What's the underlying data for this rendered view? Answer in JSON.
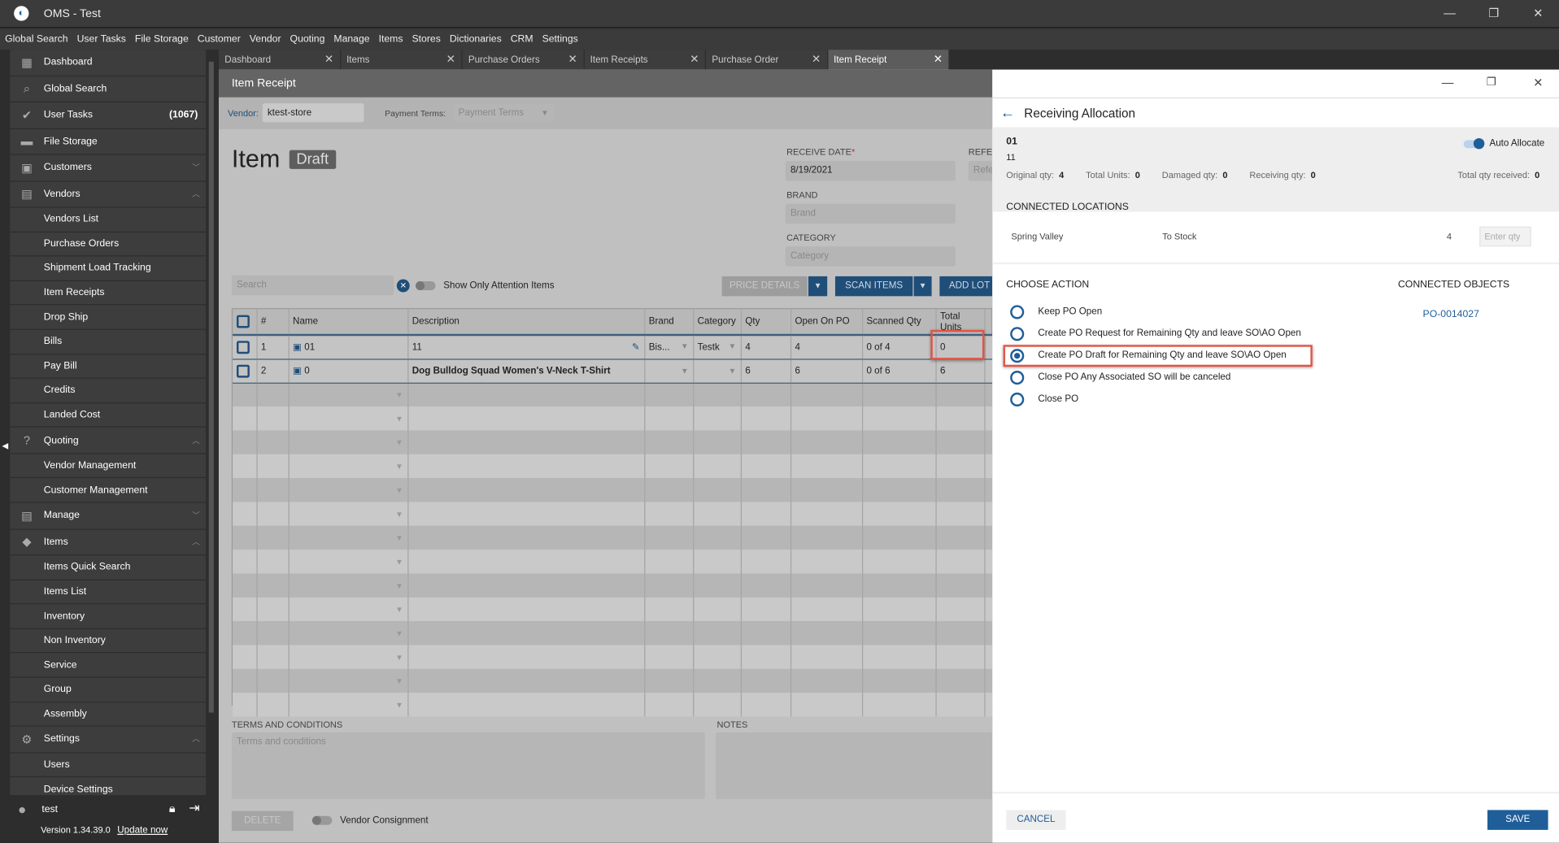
{
  "app": {
    "title": "OMS - Test"
  },
  "menu": [
    "Global Search",
    "User Tasks",
    "File Storage",
    "Customer",
    "Vendor",
    "Quoting",
    "Manage",
    "Items",
    "Stores",
    "Dictionaries",
    "CRM",
    "Settings"
  ],
  "sidebar": {
    "items": [
      {
        "label": "Dashboard",
        "icon": "dashboard-icon",
        "glyph": "▦",
        "head": true
      },
      {
        "label": "Global Search",
        "icon": "search-icon",
        "glyph": "⌕",
        "head": true
      },
      {
        "label": "User Tasks",
        "icon": "check-circle-icon",
        "glyph": "✔",
        "head": true,
        "count": "(1067)"
      },
      {
        "label": "File Storage",
        "icon": "folder-icon",
        "glyph": "▬",
        "head": true
      },
      {
        "label": "Customers",
        "icon": "person-card-icon",
        "glyph": "▣",
        "head": true,
        "chev": "down"
      },
      {
        "label": "Vendors",
        "icon": "store-icon",
        "glyph": "▤",
        "head": true,
        "chev": "up"
      },
      {
        "label": "Vendors List"
      },
      {
        "label": "Purchase Orders"
      },
      {
        "label": "Shipment Load Tracking"
      },
      {
        "label": "Item Receipts"
      },
      {
        "label": "Drop Ship"
      },
      {
        "label": "Bills"
      },
      {
        "label": "Pay Bill"
      },
      {
        "label": "Credits"
      },
      {
        "label": "Landed Cost"
      },
      {
        "label": "Quoting",
        "icon": "quote-icon",
        "glyph": "?",
        "head": true,
        "chev": "up"
      },
      {
        "label": "Vendor Management"
      },
      {
        "label": "Customer Management"
      },
      {
        "label": "Manage",
        "icon": "clipboard-icon",
        "glyph": "▤",
        "head": true,
        "chev": "down"
      },
      {
        "label": "Items",
        "icon": "tag-icon",
        "glyph": "◆",
        "head": true,
        "chev": "up"
      },
      {
        "label": "Items Quick Search"
      },
      {
        "label": "Items List"
      },
      {
        "label": "Inventory"
      },
      {
        "label": "Non Inventory"
      },
      {
        "label": "Service"
      },
      {
        "label": "Group"
      },
      {
        "label": "Assembly"
      },
      {
        "label": "Settings",
        "icon": "gear-icon",
        "glyph": "⚙",
        "head": true,
        "chev": "up"
      },
      {
        "label": "Users"
      },
      {
        "label": "Device Settings"
      }
    ],
    "user": "test",
    "version": "Version 1.34.39.0",
    "update": "Update now"
  },
  "tabs": [
    "Dashboard",
    "Items",
    "Purchase Orders",
    "Item Receipts",
    "Purchase Order",
    "Item Receipt"
  ],
  "receipt": {
    "window_title": "Item Receipt",
    "vendor_label": "Vendor:",
    "vendor": "ktest-store",
    "payment_terms_label": "Payment Terms:",
    "payment_terms_placeholder": "Payment Terms",
    "title": "Item",
    "status": "Draft",
    "receive_date_label": "RECEIVE DATE",
    "receive_date": "8/19/2021",
    "reference_label": "REFER",
    "reference_placeholder": "Refe",
    "brand_label": "BRAND",
    "brand_placeholder": "Brand",
    "category_label": "CATEGORY",
    "category_placeholder": "Category",
    "search_placeholder": "Search",
    "attention_label": "Show Only Attention Items",
    "price_details": "PRICE DETAILS",
    "scan_items": "SCAN ITEMS",
    "add_lot": "ADD LOT",
    "columns": [
      "#",
      "Name",
      "Description",
      "Brand",
      "Category",
      "Qty",
      "Open On PO",
      "Scanned Qty",
      "Total Units"
    ],
    "rows": [
      {
        "n": "1",
        "name": "01",
        "desc": "11",
        "brand": "Bis...",
        "category": "Testk",
        "qty": "4",
        "open": "4",
        "scanned": "0 of 4",
        "total": "0"
      },
      {
        "n": "2",
        "name": "0",
        "desc": "Dog Bulldog Squad Women's V-Neck T-Shirt",
        "brand": "",
        "category": "",
        "qty": "6",
        "open": "6",
        "scanned": "0 of 6",
        "total": "6"
      }
    ],
    "terms_label": "TERMS AND CONDITIONS",
    "terms_placeholder": "Terms and conditions",
    "notes_label": "NOTES",
    "delete": "DELETE",
    "consignment": "Vendor Consignment"
  },
  "allocation": {
    "title": "Receiving Allocation",
    "item_name": "01",
    "item_desc": "11",
    "auto_allocate": "Auto Allocate",
    "stats": [
      {
        "label": "Original qty:",
        "value": "4"
      },
      {
        "label": "Total Units:",
        "value": "0"
      },
      {
        "label": "Damaged qty:",
        "value": "0"
      },
      {
        "label": "Receiving qty:",
        "value": "0"
      }
    ],
    "total_received_label": "Total qty received:",
    "total_received": "0",
    "locations_label": "CONNECTED LOCATIONS",
    "location": "Spring Valley",
    "destination": "To Stock",
    "loc_qty": "4",
    "qty_placeholder": "Enter qty",
    "action_label": "CHOOSE ACTION",
    "actions": [
      "Keep PO Open",
      "Create PO Request for Remaining Qty and leave SO\\AO Open",
      "Create PO Draft for Remaining Qty and leave SO\\AO Open",
      "Close PO Any Associated SO will be canceled",
      "Close PO"
    ],
    "selected_action": 2,
    "objects_label": "CONNECTED OBJECTS",
    "object": "PO-0014027",
    "cancel": "CANCEL",
    "save": "SAVE"
  },
  "colors": {
    "accent": "#1f5e99",
    "highlight": "#e25444",
    "scanned": "#c62828"
  }
}
